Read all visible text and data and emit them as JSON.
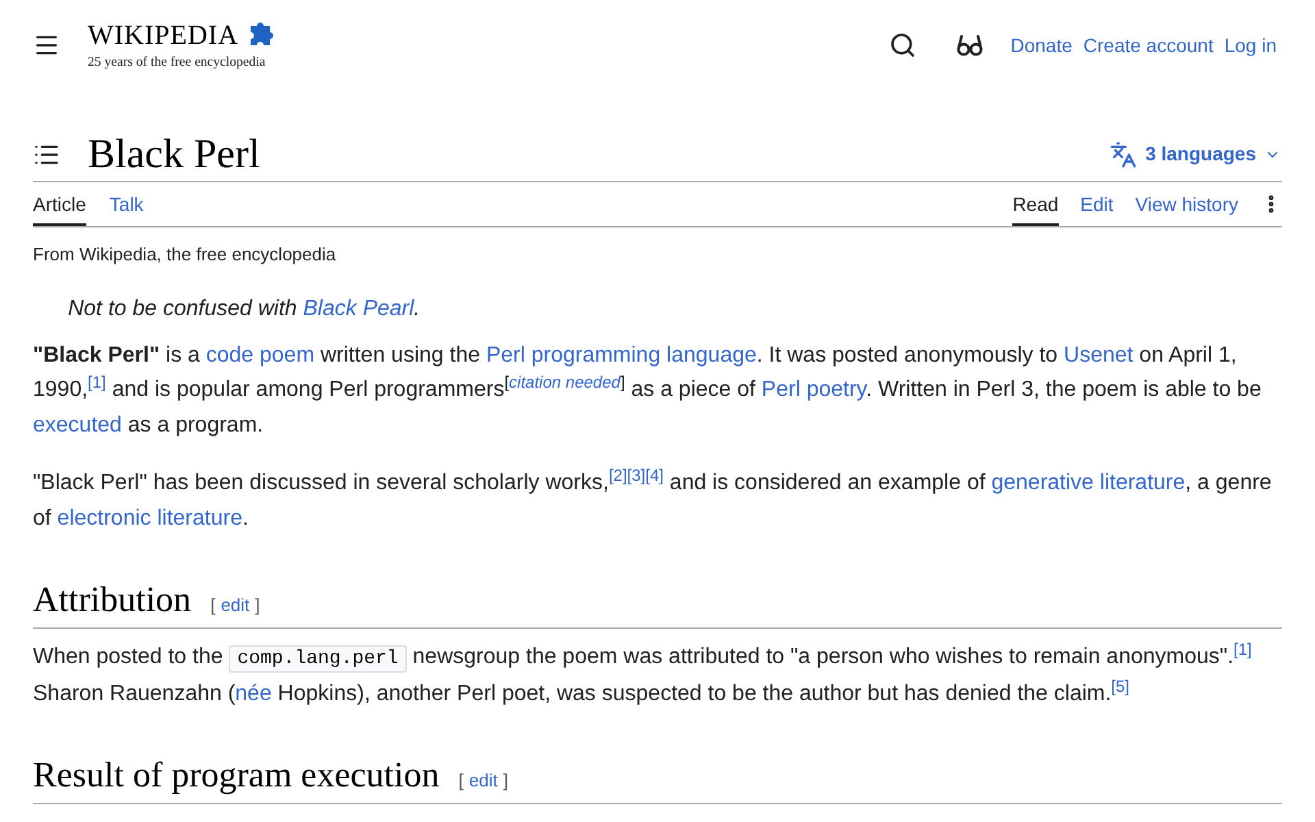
{
  "header": {
    "logo": {
      "wordmark": "WIKIPEDIA",
      "tagline": "25 years of the free encyclopedia"
    },
    "links": [
      "Donate",
      "Create account",
      "Log in"
    ]
  },
  "title": "Black Perl",
  "languages": "3 languages",
  "namespace_tabs": [
    {
      "label": "Article",
      "selected": true
    },
    {
      "label": "Talk",
      "selected": false
    }
  ],
  "view_tabs": [
    {
      "label": "Read",
      "selected": true
    },
    {
      "label": "Edit",
      "selected": false
    },
    {
      "label": "View history",
      "selected": false
    }
  ],
  "tagline": "From Wikipedia, the free encyclopedia",
  "hatnote": [
    {
      "kind": "text",
      "text": "Not to be confused with "
    },
    {
      "kind": "link",
      "text": "Black Pearl"
    },
    {
      "kind": "text",
      "text": "."
    }
  ],
  "paragraphs": [
    [
      {
        "kind": "bold",
        "text": "\"Black Perl\""
      },
      {
        "kind": "text",
        "text": " is a "
      },
      {
        "kind": "link",
        "text": "code poem"
      },
      {
        "kind": "text",
        "text": " written using the "
      },
      {
        "kind": "link",
        "text": "Perl programming language"
      },
      {
        "kind": "text",
        "text": ". It was posted anonymously to "
      },
      {
        "kind": "link",
        "text": "Usenet"
      },
      {
        "kind": "text",
        "text": " on April 1, 1990,"
      },
      {
        "kind": "ref",
        "text": "[1]"
      },
      {
        "kind": "text",
        "text": " and is popular among Perl programmers"
      },
      {
        "kind": "sup",
        "text": "["
      },
      {
        "kind": "note",
        "text": "citation needed"
      },
      {
        "kind": "sup",
        "text": "]"
      },
      {
        "kind": "text",
        "text": " as a piece of "
      },
      {
        "kind": "link",
        "text": "Perl poetry"
      },
      {
        "kind": "text",
        "text": ". Written in Perl 3, the poem is able to be "
      },
      {
        "kind": "link",
        "text": "executed"
      },
      {
        "kind": "text",
        "text": " as a program."
      }
    ],
    [
      {
        "kind": "text",
        "text": "\"Black Perl\" has been discussed in several scholarly works,"
      },
      {
        "kind": "ref",
        "text": "[2]"
      },
      {
        "kind": "ref",
        "text": "[3]"
      },
      {
        "kind": "ref",
        "text": "[4]"
      },
      {
        "kind": "text",
        "text": " and is considered an example of "
      },
      {
        "kind": "link",
        "text": "generative literature"
      },
      {
        "kind": "text",
        "text": ", a genre of "
      },
      {
        "kind": "link",
        "text": "electronic literature"
      },
      {
        "kind": "text",
        "text": "."
      }
    ]
  ],
  "sections": [
    {
      "heading": "Attribution",
      "edit": {
        "open": "[",
        "label": "edit",
        "close": "]"
      },
      "paragraphs": [
        [
          {
            "kind": "text",
            "text": "When posted to the "
          },
          {
            "kind": "code",
            "text": "comp.lang.perl"
          },
          {
            "kind": "text",
            "text": " newsgroup the poem was attributed to \"a person who wishes to remain anonymous\"."
          },
          {
            "kind": "ref",
            "text": "[1]"
          },
          {
            "kind": "text",
            "text": " Sharon Rauenzahn ("
          },
          {
            "kind": "link",
            "text": "née"
          },
          {
            "kind": "text",
            "text": " Hopkins), another Perl poet, was suspected to be the author but has denied the claim."
          },
          {
            "kind": "ref",
            "text": "[5]"
          }
        ]
      ]
    },
    {
      "heading": "Result of program execution",
      "edit": {
        "open": "[",
        "label": "edit",
        "close": "]"
      }
    }
  ]
}
